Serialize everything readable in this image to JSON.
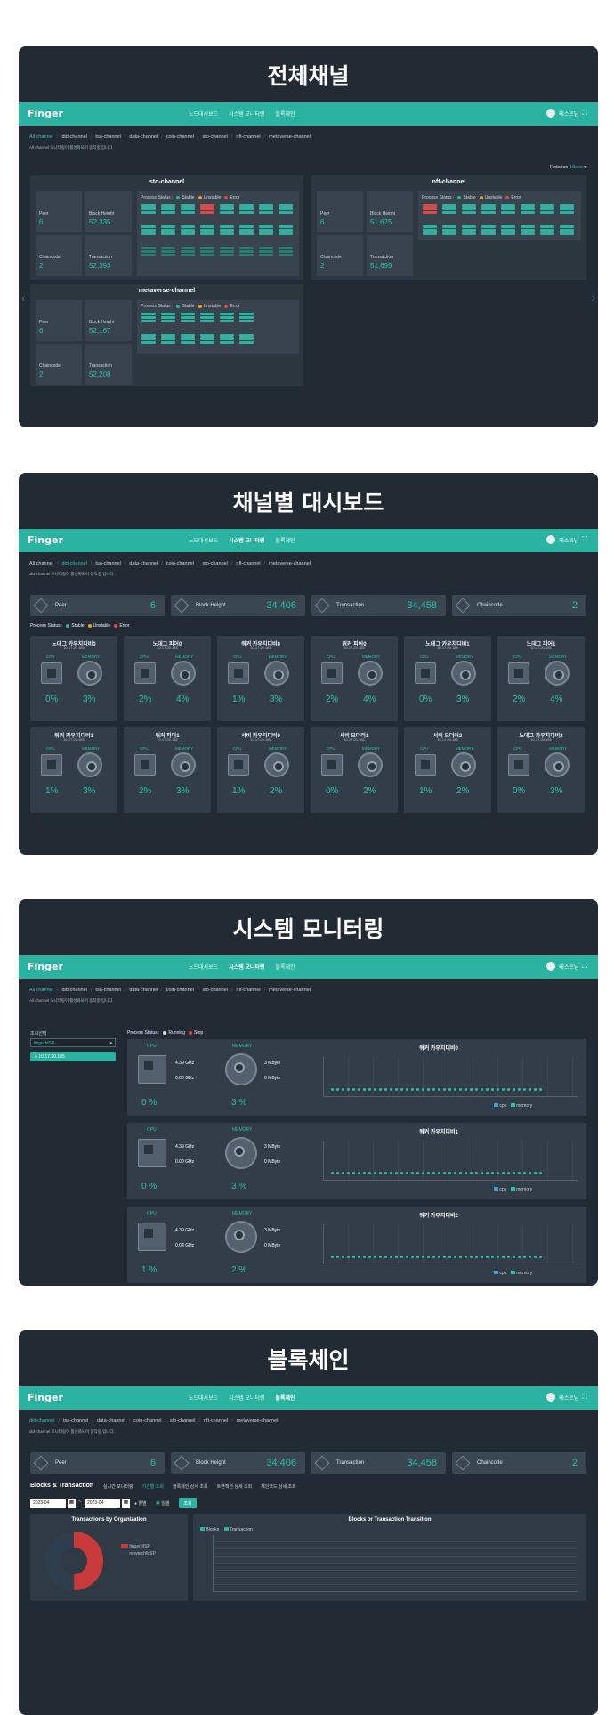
{
  "sections": [
    {
      "title": "전체채널"
    },
    {
      "title": "채널별 대시보드"
    },
    {
      "title": "시스템 모니터링"
    },
    {
      "title": "블록체인"
    }
  ],
  "app": {
    "logo": "Finger",
    "user": "테스트님",
    "nav": [
      "노드대시보드",
      "시스템 모니터링",
      "블록체인"
    ]
  },
  "s1": {
    "tabs": [
      "All channel",
      "did-channel",
      "tsa-channel",
      "data-channel",
      "coin-channel",
      "sto-channel",
      "nft-channel",
      "metaverse-channel"
    ],
    "hint": "All channel 모니터링이 활성화되어 동작중 입니다.",
    "rotation_label": "Rotation",
    "rotation_value": "10sec",
    "panels": [
      {
        "name": "sto-channel",
        "peer": "6",
        "block_height": "52,335",
        "chaincode": "2",
        "transaction": "52,393"
      },
      {
        "name": "nft-channel",
        "peer": "6",
        "block_height": "51,675",
        "chaincode": "2",
        "transaction": "51,699"
      },
      {
        "name": "metaverse-channel",
        "peer": "6",
        "block_height": "52,167",
        "chaincode": "2",
        "transaction": "52,208"
      }
    ],
    "labels": {
      "peer": "Peer",
      "block_height": "Block Height",
      "chaincode": "Chaincode",
      "transaction": "Transaction",
      "process_status": "Process Status :",
      "stable": "Stable",
      "unstable": "Unstable",
      "error": "Error"
    }
  },
  "s2": {
    "tabs": [
      "All channel",
      "did-channel",
      "tsa-channel",
      "data-channel",
      "coin-channel",
      "sto-channel",
      "nft-channel",
      "metaverse-channel"
    ],
    "hint": "did-channel 모니터링이 활성화되어 동작중 입니다.",
    "stats": [
      {
        "label": "Peer",
        "value": "6"
      },
      {
        "label": "Block Height",
        "value": "34,406"
      },
      {
        "label": "Transaction",
        "value": "34,458"
      },
      {
        "label": "Chaincode",
        "value": "2"
      }
    ],
    "legend": {
      "process_status": "Process Status :",
      "stable": "Stable",
      "unstable": "Unstable",
      "error": "Error"
    },
    "nodes": [
      {
        "name": "노데그 카우치디비0",
        "ip": "10.17.20.185",
        "cpu": "0%",
        "mem": "3%"
      },
      {
        "name": "노데그 피어0",
        "ip": "10.17.20.185",
        "cpu": "2%",
        "mem": "4%"
      },
      {
        "name": "워커 카우치디비0",
        "ip": "10.17.20.185",
        "cpu": "1%",
        "mem": "3%"
      },
      {
        "name": "워커 피어0",
        "ip": "10.17.20.185",
        "cpu": "2%",
        "mem": "4%"
      },
      {
        "name": "노데그 카우치디비1",
        "ip": "10.17.20.185",
        "cpu": "0%",
        "mem": "3%"
      },
      {
        "name": "노데그 피어1",
        "ip": "10.17.20.185",
        "cpu": "2%",
        "mem": "4%"
      },
      {
        "name": "워커 카우치디비1",
        "ip": "10.17.20.185",
        "cpu": "1%",
        "mem": "3%"
      },
      {
        "name": "워커 피어1",
        "ip": "10.17.20.185",
        "cpu": "2%",
        "mem": "3%"
      },
      {
        "name": "서비 카우치디비0",
        "ip": "10.17.20.185",
        "cpu": "1%",
        "mem": "2%"
      },
      {
        "name": "서비 오더러1",
        "ip": "10.17.20.185",
        "cpu": "0%",
        "mem": "2%"
      },
      {
        "name": "서비 오더러2",
        "ip": "10.17.20.185",
        "cpu": "1%",
        "mem": "2%"
      },
      {
        "name": "노데그 카우치디비2",
        "ip": "10.17.20.185",
        "cpu": "0%",
        "mem": "3%"
      }
    ],
    "cpu_label": "CPU",
    "mem_label": "MEMORY"
  },
  "s3": {
    "tabs": [
      "All channel",
      "did-channel",
      "tsa-channel",
      "data-channel",
      "coin-channel",
      "sto-channel",
      "nft-channel",
      "metaverse-channel"
    ],
    "hint": "All channel 모니터링이 활성화되어 동작중 입니다.",
    "org_label": "조직선택",
    "org_select": "fingerMSP",
    "ip": "10.17.20.185",
    "process_label": "Process Status :",
    "running": "Running",
    "stop": "Stop",
    "rows": [
      {
        "title": "워커 카우치디비0",
        "ghz1": "4.39 GHz",
        "ghz2": "0.00 GHz",
        "mb1": "3 MByte",
        "mb2": "0 MByte",
        "cpu": "0 %",
        "mem": "3 %"
      },
      {
        "title": "워커 카우치디비1",
        "ghz1": "4.39 GHz",
        "ghz2": "0.00 GHz",
        "mb1": "3 MByte",
        "mb2": "0 MByte",
        "cpu": "0 %",
        "mem": "3 %"
      },
      {
        "title": "워커 카우치디비2",
        "ghz1": "4.39 GHz",
        "ghz2": "0.04 GHz",
        "mb1": "3 MByte",
        "mb2": "0 MByte",
        "cpu": "1 %",
        "mem": "2 %"
      }
    ],
    "cpu_label": "CPU",
    "mem_label": "MEMORY",
    "legend_cpu": "cpu",
    "legend_mem": "memory"
  },
  "s4": {
    "tabs": [
      "did-channel",
      "tsa-channel",
      "data-channel",
      "coin-channel",
      "sto-channel",
      "nft-channel",
      "metaverse-channel"
    ],
    "hint": "did-channel 모니터링이 활성화되어 동작중 입니다.",
    "stats": [
      {
        "label": "Peer",
        "value": "6"
      },
      {
        "label": "Block Height",
        "value": "34,406"
      },
      {
        "label": "Transaction",
        "value": "34,458"
      },
      {
        "label": "Chaincode",
        "value": "2"
      }
    ],
    "heading": "Blocks & Transaction",
    "subtabs": [
      "실시간 모니터링",
      "기간별 조회",
      "블록체인 상세 조회",
      "트랜잭션 상세 조회",
      "체인코드 상세 조회"
    ],
    "date_from": "2023-04",
    "date_to": "2023-04",
    "radio_month": "월별",
    "radio_day": "일별",
    "search_button": "조회",
    "pie_title": "Transactions by Organization",
    "pie_legend": [
      "fingerMSP",
      "newtechMSP"
    ],
    "line_title": "Blocks or Transaction Transition",
    "line_legend": [
      "Blocks",
      "Transaction"
    ],
    "colors": {
      "teal": "#2bb3a1",
      "red": "#e04848",
      "dark": "#222b33"
    }
  }
}
